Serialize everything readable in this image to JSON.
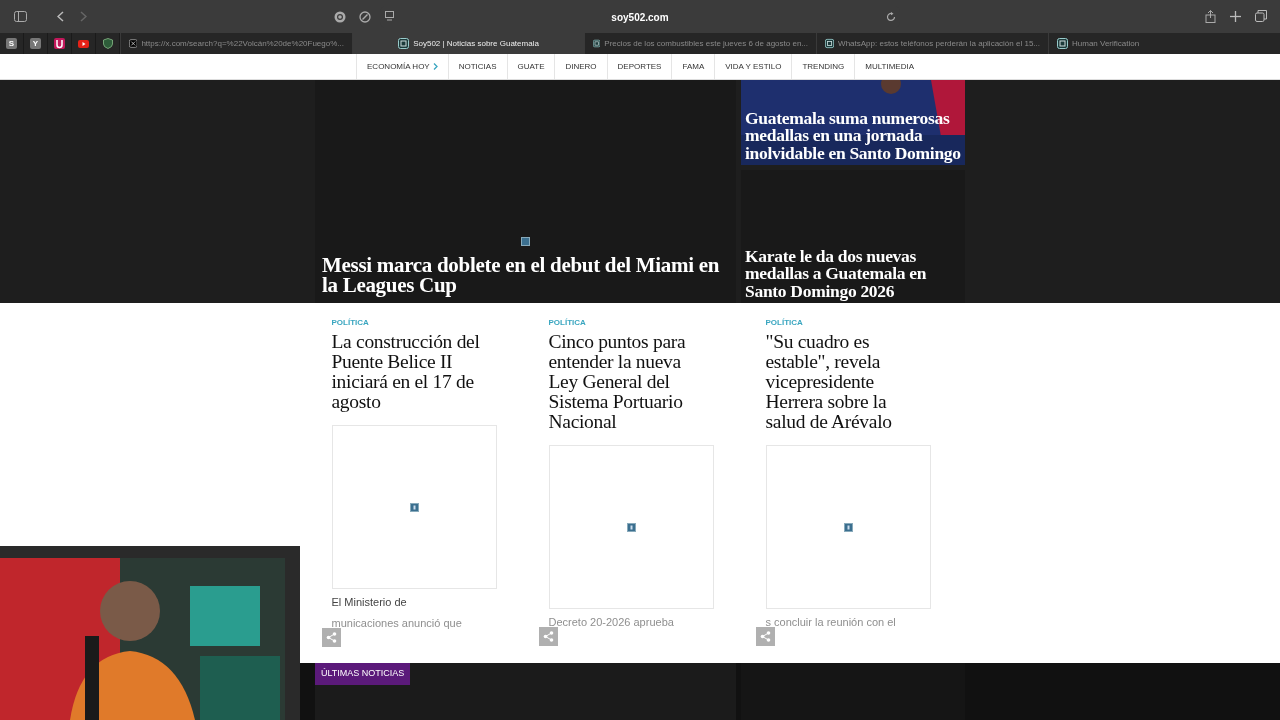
{
  "browser": {
    "address": "soy502.com",
    "pinned_tabs": [
      {
        "kind": "letter",
        "label": "S"
      },
      {
        "kind": "letter",
        "label": "Y"
      },
      {
        "kind": "u"
      },
      {
        "kind": "play"
      },
      {
        "kind": "shield"
      }
    ],
    "tabs": [
      {
        "title": "https://x.com/search?q=%22Volcán%20de%20Fuego%...",
        "selected": false
      },
      {
        "title": "Soy502 | Noticias sobre Guatemala",
        "selected": true
      },
      {
        "title": "Precios de los combustibles este jueves 6 de agosto en...",
        "selected": false
      },
      {
        "title": "WhatsApp: estos teléfonos perderán la aplicación el 15...",
        "selected": false
      },
      {
        "title": "Human Verification",
        "selected": false
      }
    ]
  },
  "nav": {
    "items": [
      {
        "label": "ECONOMÍA HOY",
        "kind": "more"
      },
      {
        "label": "NOTICIAS",
        "kind": "link"
      },
      {
        "label": "GUATE",
        "kind": "link"
      },
      {
        "label": "DINERO",
        "kind": "link"
      },
      {
        "label": "DEPORTES",
        "kind": "link"
      },
      {
        "label": "FAMA",
        "kind": "link"
      },
      {
        "label": "VIDA Y ESTILO",
        "kind": "link"
      },
      {
        "label": "TRENDING",
        "kind": "link"
      },
      {
        "label": "MULTIMEDIA",
        "kind": "link"
      }
    ]
  },
  "hero": {
    "main": {
      "title": "Messi marca doblete en el debut del Miami en la Leagues Cup"
    },
    "side": [
      {
        "title": "Guatemala suma numerosas medallas en una jornada inolvidable en Santo Domingo",
        "kind": "picture"
      },
      {
        "title": "Karate le da dos nuevas medallas a Guatemala en Santo Domingo 2026",
        "kind": "dark"
      }
    ]
  },
  "cards": [
    {
      "category": "POLÍTICA",
      "title": "La construcción del Puente Belice II iniciará en el 17 de agosto",
      "excerpt": [
        {
          "text": "El Ministerio de",
          "faded": false
        },
        {
          "text": "municaciones anunció que",
          "faded": true
        }
      ]
    },
    {
      "category": "POLÍTICA",
      "title": "Cinco puntos para entender la nueva Ley General del Sistema Portuario Nacional",
      "excerpt": [
        {
          "text": "Decreto 20-2026 aprueba",
          "faded": true
        }
      ]
    },
    {
      "category": "POLÍTICA",
      "title": "\"Su cuadro es estable\", revela vicepresidente Herrera sobre la salud de Arévalo",
      "excerpt": [
        {
          "text": "s concluir la reunión con el",
          "faded": true
        }
      ]
    }
  ],
  "latest": {
    "label": "ÚLTIMAS NOTICIAS"
  }
}
